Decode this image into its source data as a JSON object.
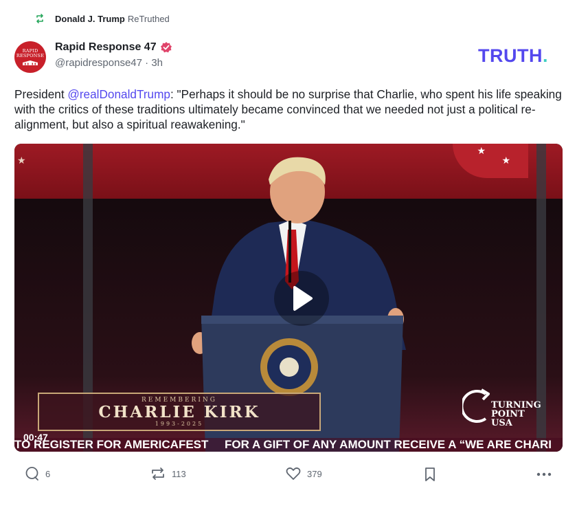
{
  "retruth": {
    "icon": "retruth-icon",
    "name": "Donald J. Trump",
    "verb": "ReTruthed"
  },
  "author": {
    "display_name": "Rapid Response 47",
    "handle": "@rapidresponse47",
    "time": "· 3h",
    "avatar_text": [
      "RAPID",
      "RESPONSE"
    ],
    "verified_icon": "verified-badge-icon"
  },
  "logo": {
    "text": "TRUTH",
    "dot": "."
  },
  "post": {
    "prefix": "President ",
    "mention": "@realDonaldTrump",
    "body": ": \"Perhaps it should be no surprise that Charlie, who spent his life speaking with the critics of these traditions ultimately became convinced that we needed not just a political re-alignment, but also a spiritual reawakening.\""
  },
  "video": {
    "duration": "00:47",
    "banner_pre": "REMEMBERING",
    "banner_title": "CHARLIE KIRK",
    "banner_years": "1993-2025",
    "tpusa": [
      "TURNING",
      "POINT USA"
    ],
    "ticker": "TO REGISTER FOR AMERICAFEST     FOR A GIFT OF ANY AMOUNT RECEIVE A “WE ARE CHARI",
    "play_icon": "play-icon"
  },
  "actions": {
    "replies": "6",
    "retruths": "113",
    "likes": "379"
  },
  "colors": {
    "brand": "#5448ee",
    "accent": "#3ecfc2",
    "verified": "#e0446a"
  }
}
